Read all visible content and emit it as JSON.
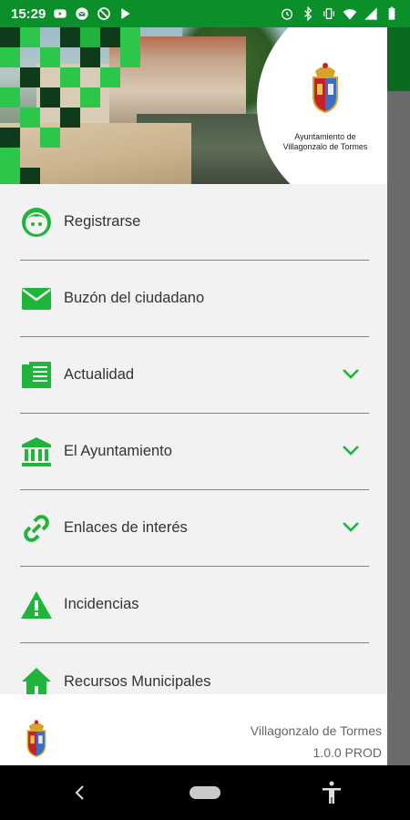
{
  "status_bar": {
    "time": "15:29",
    "left_icons": [
      "youtube-icon",
      "mail-icon",
      "vpn-icon",
      "play-store-icon"
    ],
    "right_icons": [
      "alarm-icon",
      "bluetooth-icon",
      "vibrate-icon",
      "wifi-icon",
      "signal-icon",
      "battery-icon"
    ]
  },
  "drawer": {
    "header": {
      "emblem_caption_line1": "Ayuntamiento de",
      "emblem_caption_line2": "Villagonzalo de Tormes",
      "accent_green": "#1fb53a"
    },
    "items": [
      {
        "label": "Registrarse",
        "icon": "face-icon",
        "expandable": false
      },
      {
        "label": "Buzón del ciudadano",
        "icon": "mail-icon",
        "expandable": false
      },
      {
        "label": "Actualidad",
        "icon": "newspaper-icon",
        "expandable": true
      },
      {
        "label": "El Ayuntamiento",
        "icon": "institution-icon",
        "expandable": true
      },
      {
        "label": "Enlaces de interés",
        "icon": "link-icon",
        "expandable": true
      },
      {
        "label": "Incidencias",
        "icon": "warning-icon",
        "expandable": false
      },
      {
        "label": "Recursos Municipales",
        "icon": "home-icon",
        "expandable": false
      }
    ],
    "footer": {
      "name": "Villagonzalo de Tormes",
      "version": "1.0.0 PROD"
    }
  },
  "nav_bar": {
    "icons": [
      "back-icon",
      "home-pill-icon",
      "accessibility-icon"
    ]
  },
  "colors": {
    "status_bar": "#0b8f2a",
    "accent": "#1fb53a",
    "drawer_bg": "#f2f2f2",
    "scrim": "#6b6b6b"
  }
}
